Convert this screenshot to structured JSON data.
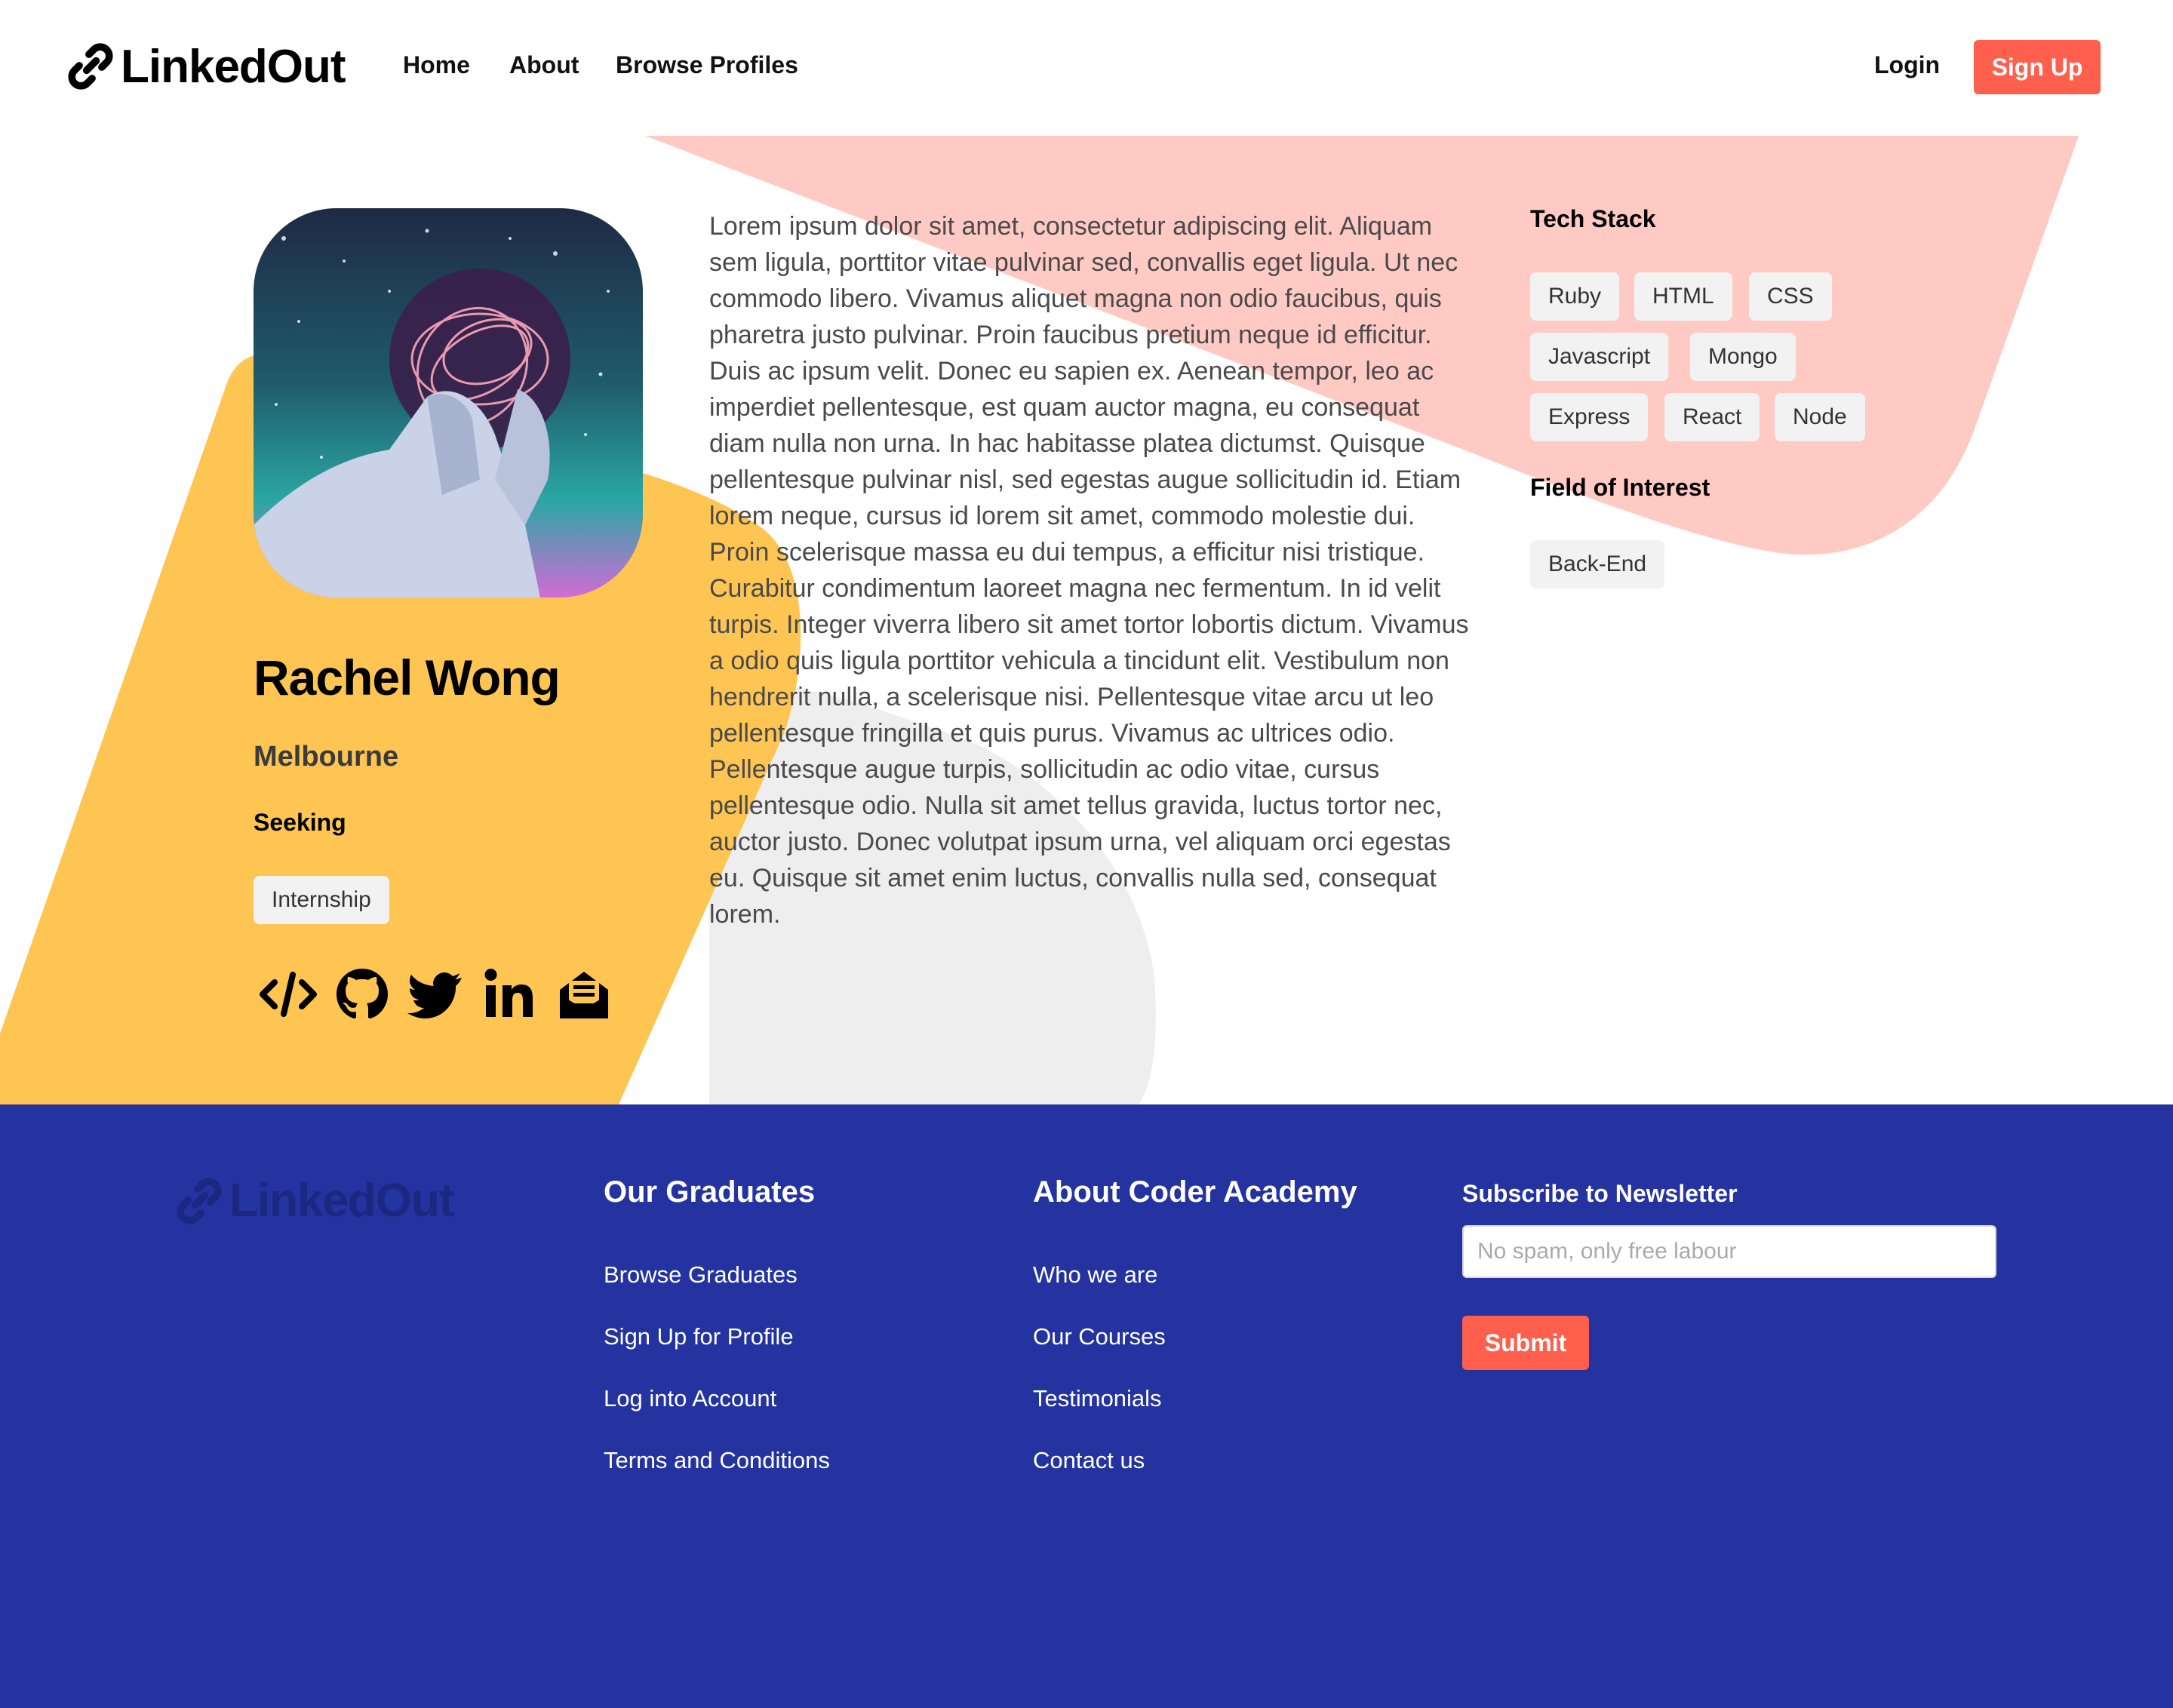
{
  "nav": {
    "brand": "LinkedOut",
    "links": [
      "Home",
      "About",
      "Browse Profiles"
    ],
    "login": "Login",
    "signup": "Sign Up"
  },
  "profile": {
    "name": "Rachel Wong",
    "city": "Melbourne",
    "seeking_label": "Seeking",
    "seeking": [
      "Internship"
    ],
    "social_icons": [
      "code-icon",
      "github-icon",
      "twitter-icon",
      "linkedin-icon",
      "mail-icon"
    ],
    "bio": "Lorem ipsum dolor sit amet, consectetur adipiscing elit. Aliquam sem ligula, porttitor vitae pulvinar sed, convallis eget ligula. Ut nec commodo libero. Vivamus aliquet magna non odio faucibus, quis pharetra justo pulvinar. Proin faucibus pretium neque id efficitur. Duis ac ipsum velit. Donec eu sapien ex. Aenean tempor, leo ac imperdiet pellentesque, est quam auctor magna, eu consequat diam nulla non urna. In hac habitasse platea dictumst. Quisque pellentesque pulvinar nisl, sed egestas augue sollicitudin id. Etiam lorem neque, cursus id lorem sit amet, commodo molestie dui. Proin scelerisque massa eu dui tempus, a efficitur nisi tristique. Curabitur condimentum laoreet magna nec fermentum. In id velit turpis. Integer viverra libero sit amet tortor lobortis dictum. Vivamus a odio quis ligula porttitor vehicula a tincidunt elit. Vestibulum non hendrerit nulla, a scelerisque nisi. Pellentesque vitae arcu ut leo pellentesque fringilla et quis purus. Vivamus ac ultrices odio. Pellentesque augue turpis, sollicitudin ac odio vitae, cursus pellentesque odio. Nulla sit amet tellus gravida, luctus tortor nec, auctor justo. Donec volutpat ipsum urna, vel aliquam orci egestas eu. Quisque sit amet enim luctus, convallis nulla sed, consequat lorem.",
    "tech_stack_title": "Tech Stack",
    "tech_stack": [
      "Ruby",
      "HTML",
      "CSS",
      "Javascript",
      "Mongo",
      "Express",
      "React",
      "Node"
    ],
    "interest_title": "Field of Interest",
    "interests": [
      "Back-End"
    ]
  },
  "footer": {
    "brand": "LinkedOut",
    "col1": {
      "title": "Our Graduates",
      "links": [
        "Browse Graduates",
        "Sign Up for Profile",
        "Log into Account",
        "Terms and Conditions"
      ]
    },
    "col2": {
      "title": "About Coder Academy",
      "links": [
        "Who we are",
        "Our Courses",
        "Testimonials",
        "Contact us"
      ]
    },
    "newsletter": {
      "title": "Subscribe to Newsletter",
      "placeholder": "No spam, only free labour",
      "value": "",
      "submit": "Submit"
    }
  },
  "colors": {
    "accent": "#ff5f4d",
    "yellow": "#fec553",
    "pink": "#ffcac4",
    "grey_blob": "#eeeeee",
    "footer_bg": "#2433a0"
  }
}
